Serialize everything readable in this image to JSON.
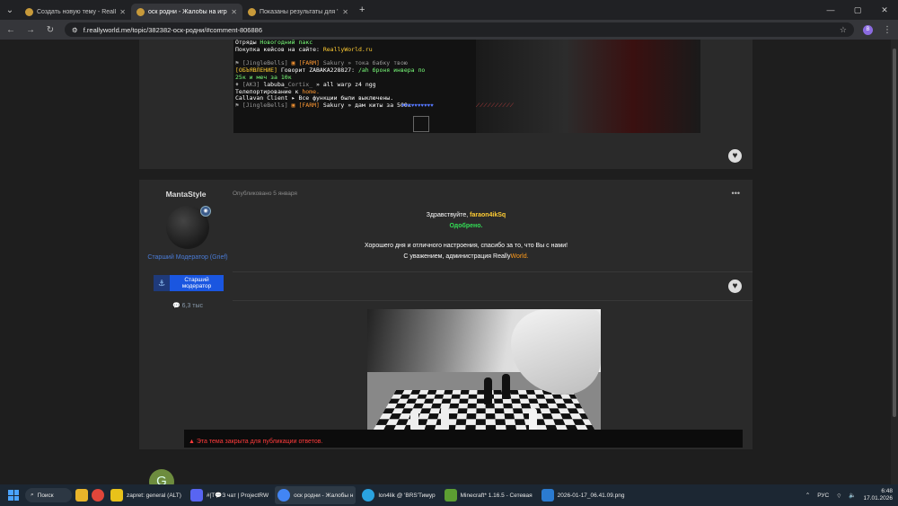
{
  "browser": {
    "tabs": [
      {
        "label": "Создать новую тему - ReallyWorl",
        "active": false
      },
      {
        "label": "оск родни - Жалобы на игрок",
        "active": true
      },
      {
        "label": "Показаны результаты для 'ma",
        "active": false
      }
    ],
    "new_tab": "+",
    "window_controls": [
      "—",
      "▢",
      "✕"
    ],
    "url": "f.reallyworld.me/topic/382382-оск-родни/#comment-806886",
    "profile_letter": "B"
  },
  "minecraft_chat": [
    {
      "parts": [
        [
          "Отряды ",
          ""
        ],
        [
          "Новогодний пакс",
          "c-g"
        ]
      ]
    },
    {
      "parts": [
        [
          "Покупка кейсов на сайте: ",
          ""
        ],
        [
          "ReallyWorld.ru",
          "c-y"
        ]
      ]
    },
    {
      "parts": [
        [
          "",
          ""
        ]
      ]
    },
    {
      "parts": [
        [
          "⚑ [JingleBells] ",
          "c-gray"
        ],
        [
          "▣ [FARM] ",
          "c-o"
        ],
        [
          "Sakury ",
          "c-gray"
        ],
        [
          "» тока бабку твою",
          "c-gray"
        ]
      ]
    },
    {
      "parts": [
        [
          "[ОБЪЯВЛЕНИЕ] ",
          "c-y"
        ],
        [
          "Говорит ",
          ""
        ],
        [
          "ZABAKA228827: ",
          ""
        ],
        [
          "/ah броня инвера по",
          "c-g"
        ]
      ]
    },
    {
      "parts": [
        [
          "25к и меч за 10к",
          "c-g"
        ]
      ]
    },
    {
      "parts": [
        [
          "♦ [AK3] ",
          "c-gray"
        ],
        [
          "labuba_",
          ""
        ],
        [
          "Cortix_ ",
          "c-gray"
        ],
        [
          "» all warp z4 ngg",
          ""
        ]
      ]
    },
    {
      "parts": [
        [
          "Телепортирование к ",
          ""
        ],
        [
          "home.",
          "c-o"
        ]
      ]
    },
    {
      "parts": [
        [
          "Callavan Client ",
          ""
        ],
        [
          "▸ Все функции были выключены.",
          ""
        ]
      ]
    },
    {
      "parts": [
        [
          "⚑ [JingleBells] ",
          "c-gray"
        ],
        [
          "▣ [FARM] ",
          "c-o"
        ],
        [
          "Sakury ",
          ""
        ],
        [
          "» дам киты за 500к",
          ""
        ]
      ]
    }
  ],
  "post": {
    "author": "MantaStyle",
    "date": "Опубликовано 5 января",
    "menu": "•••",
    "role_text": "Старший Модератор (Grief)",
    "role_badge": "Старший модератор",
    "posts_count": "6,3 тыс",
    "greeting": "Здравствуйте,",
    "user": "faraon4ikSq",
    "status": "Одобрено.",
    "line1": "Хорошего дня и отличного настроения, спасибо за то, что Вы с нами!",
    "line2_prefix": "С уважением, администрация Really",
    "line2_suffix": "World."
  },
  "locked_notice": "Эта тема закрыта для публикации ответов.",
  "taskbar": {
    "search": "Поиск",
    "apps": [
      {
        "label": "zapret: general (ALT)",
        "color": "#e8c21a"
      },
      {
        "label": "#|Т💬З чат | ProjectRW",
        "color": "#5865f2"
      },
      {
        "label": "оск родни - Жалобы н",
        "color": "#4285f4"
      },
      {
        "label": "lon4lik @ 'BRS'Тимур",
        "color": "#2aa3e0"
      },
      {
        "label": "Minecraft* 1.16.5 - Сетевая",
        "color": "#5c9e32"
      },
      {
        "label": "2026-01-17_06.41.09.png",
        "color": "#2b7bd1"
      }
    ],
    "lang": "РУС",
    "time": "6:48",
    "date": "17.01.2026"
  }
}
